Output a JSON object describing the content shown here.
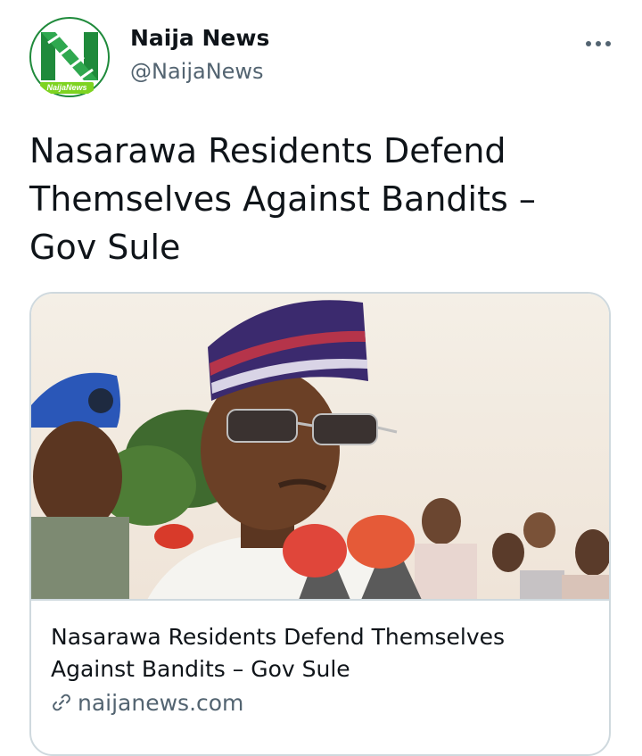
{
  "author": {
    "display_name": "Naija News",
    "handle": "@NaijaNews",
    "avatar_icon": "naija-news-logo-icon",
    "avatar_logo_text": "NaijaNews",
    "brand_green": "#1f8a3b",
    "brand_light_green": "#7ed321"
  },
  "menu": {
    "icon": "more-horizontal-icon"
  },
  "tweet": {
    "text": "Nasarawa Residents Defend Themselves Against Bandits – Gov Sule"
  },
  "link_card": {
    "image_description_icon": "news-photo",
    "title": "Nasarawa Residents Defend Themselves Against Bandits – Gov Sule",
    "domain": "naijanews.com",
    "domain_icon": "link-icon"
  },
  "colors": {
    "text_primary": "#0f1419",
    "text_secondary": "#536471",
    "border": "#cfd9de"
  }
}
